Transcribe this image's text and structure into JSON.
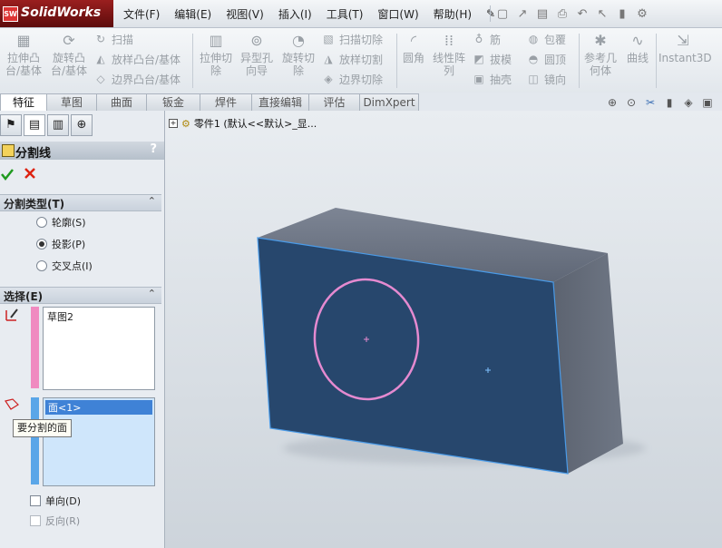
{
  "app": {
    "name": "SolidWorks",
    "logo_text": "SW"
  },
  "menu": [
    "文件(F)",
    "编辑(E)",
    "视图(V)",
    "插入(I)",
    "工具(T)",
    "窗口(W)",
    "帮助(H)"
  ],
  "ribbon": {
    "extrude_boss": "拉伸凸\n台/基体",
    "revolve_boss": "旋转凸\n台/基体",
    "sweep": "扫描",
    "loft": "放样凸台/基体",
    "boundary": "边界凸台/基体",
    "extrude_cut": "拉伸切\n除",
    "hole_wizard": "异型孔\n向导",
    "revolve_cut": "旋转切\n除",
    "sweep_cut": "扫描切除",
    "loft_cut": "放样切割",
    "boundary_cut": "边界切除",
    "fillet": "圆角",
    "linear_pattern": "线性阵\n列",
    "rib": "筋",
    "draft": "拔模",
    "shell": "抽壳",
    "wrap": "包覆",
    "dome": "圆顶",
    "mirror": "镜向",
    "ref_geom": "参考几\n何体",
    "curves": "曲线",
    "instant3d": "Instant3D"
  },
  "tabs": [
    "特征",
    "草图",
    "曲面",
    "钣金",
    "焊件",
    "直接编辑",
    "评估",
    "DimXpert"
  ],
  "active_tab": "特征",
  "panel": {
    "title": "分割线",
    "help": "?",
    "split_type_label": "分割类型(T)",
    "split_options": [
      "轮廓(S)",
      "投影(P)",
      "交叉点(I)"
    ],
    "selected_split": "投影(P)",
    "selection_label": "选择(E)",
    "sketch_item": "草图2",
    "face_item": "面<1>",
    "tooltip": "要分割的面",
    "single_direction": "单向(D)",
    "reverse": "反向(R)",
    "sketch_color": "#f08ac0",
    "face_color": "#5aa6e8"
  },
  "tree": {
    "label": "零件1  (默认<<默认>_显..."
  },
  "model": {
    "face_color": "#27476d",
    "circle_color": "#e58ad0",
    "edge_highlight": "#4a9be8"
  }
}
